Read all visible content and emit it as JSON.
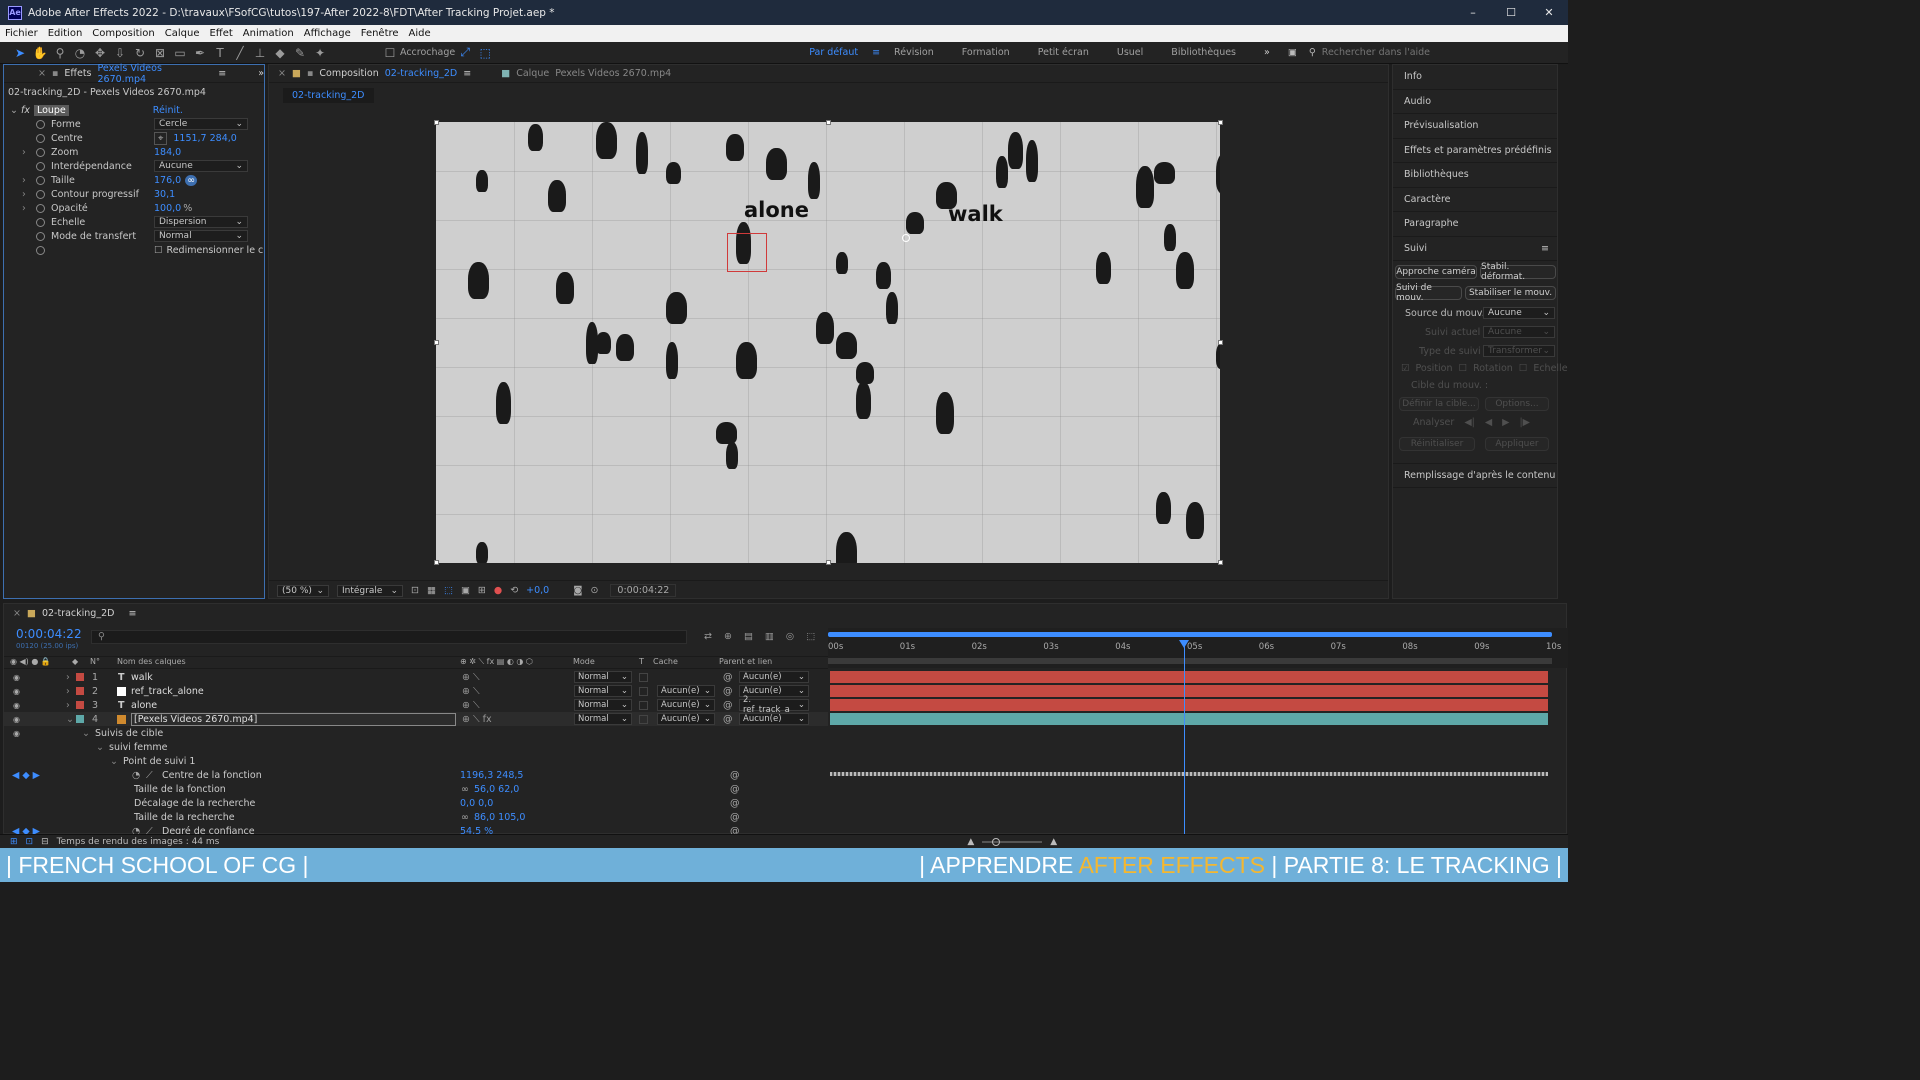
{
  "window": {
    "app_label": "Ae",
    "title": "Adobe After Effects 2022 - D:\\travaux\\FSofCG\\tutos\\197-After 2022-8\\FDT\\After Tracking Projet.aep *",
    "minimize": "–",
    "maximize": "☐",
    "close": "✕"
  },
  "menu": [
    "Fichier",
    "Edition",
    "Composition",
    "Calque",
    "Effet",
    "Animation",
    "Affichage",
    "Fenêtre",
    "Aide"
  ],
  "toolbar": {
    "snap_label": "Accrochage",
    "workspaces": [
      "Par défaut",
      "Révision",
      "Formation",
      "Petit écran",
      "Usuel",
      "Bibliothèques"
    ],
    "active_workspace": "Par défaut",
    "more": "»",
    "search_placeholder": "Rechercher dans l'aide"
  },
  "effects_panel": {
    "tab_label": "Effets",
    "tab_layer": "Pexels Videos 2670.mp4",
    "path": "02-tracking_2D - Pexels Videos 2670.mp4",
    "fx_label": "fx",
    "effect_name": "Loupe",
    "reset": "Réinit.",
    "props": [
      {
        "name": "Forme",
        "value": "Cercle",
        "kind": "dropdown"
      },
      {
        "name": "Centre",
        "value": "1151,7 284,0",
        "kind": "point"
      },
      {
        "name": "Zoom",
        "value": "184,0",
        "kind": "value"
      },
      {
        "name": "Interdépendance",
        "value": "Aucune",
        "kind": "dropdown"
      },
      {
        "name": "Taille",
        "value": "176,0",
        "kind": "value"
      },
      {
        "name": "Contour progressif",
        "value": "30,1",
        "kind": "value"
      },
      {
        "name": "Opacité",
        "value": "100,0",
        "unit": "%",
        "kind": "value"
      },
      {
        "name": "Echelle",
        "value": "Dispersion",
        "kind": "dropdown"
      },
      {
        "name": "Mode de transfert",
        "value": "Normal",
        "kind": "dropdown"
      },
      {
        "name": "",
        "value": "Redimensionner le c",
        "kind": "checkbox"
      }
    ]
  },
  "comp_panel": {
    "tab_label": "Composition",
    "comp_name": "02-tracking_2D",
    "layer_tab_label": "Calque",
    "layer_tab_name": "Pexels Videos 2670.mp4",
    "subtab": "02-tracking_2D",
    "overlay_texts": [
      "alone",
      "walk"
    ],
    "footer": {
      "zoom": "(50 %)",
      "resolution": "Intégrale",
      "exposure": "+0,0",
      "timecode": "0:00:04:22"
    }
  },
  "right_panel": {
    "items": [
      "Info",
      "Audio",
      "Prévisualisation",
      "Effets et paramètres prédéfinis",
      "Bibliothèques",
      "Caractère",
      "Paragraphe"
    ],
    "tracker": {
      "title": "Suivi",
      "buttons": [
        "Approche caméra",
        "Stabil. déformat.",
        "Suivi de mouv.",
        "Stabiliser le mouv."
      ],
      "source_label": "Source du mouv. :",
      "source_value": "Aucune",
      "current_label": "Suivi actuel",
      "current_value": "Aucune",
      "type_label": "Type de suivi",
      "type_value": "Transformer",
      "checks": [
        "Position",
        "Rotation",
        "Echelle"
      ],
      "target_label": "Cible du mouv. :",
      "define_target": "Définir la cible...",
      "options": "Options...",
      "analyze": "Analyser",
      "reset": "Réinitialiser",
      "apply": "Appliquer"
    },
    "fill_label": "Remplissage d'après le contenu"
  },
  "timeline": {
    "tab": "02-tracking_2D",
    "timecode": "0:00:04:22",
    "frame_info": "00120 (25.00 ips)",
    "columns": {
      "num": "N°",
      "name": "Nom des calques",
      "mode": "Mode",
      "t": "T",
      "matte": "Cache",
      "parent": "Parent et lien"
    },
    "ruler": [
      "00s",
      "01s",
      "02s",
      "03s",
      "04s",
      "05s",
      "06s",
      "07s",
      "08s",
      "09s",
      "10s"
    ],
    "playhead_seconds": 4.88,
    "duration_seconds": 10,
    "layers": [
      {
        "num": "1",
        "type": "T",
        "name": "walk",
        "mode": "Normal",
        "matte": "",
        "parent": "Aucun(e)",
        "color": "#c44a42"
      },
      {
        "num": "2",
        "type": "",
        "name": "ref_track_alone",
        "mode": "Normal",
        "matte": "Aucun(e)",
        "parent": "Aucun(e)",
        "color": "#c44a42"
      },
      {
        "num": "3",
        "type": "T",
        "name": "alone",
        "mode": "Normal",
        "matte": "Aucun(e)",
        "parent": "2. ref_track_a",
        "color": "#c44a42"
      },
      {
        "num": "4",
        "type": "",
        "name": "[Pexels Videos 2670.mp4]",
        "mode": "Normal",
        "matte": "Aucun(e)",
        "parent": "Aucun(e)",
        "color": "#5ea8a8"
      }
    ],
    "tree": [
      "Suivis de cible",
      "suivi femme",
      "Point de suivi 1"
    ],
    "track_props": [
      {
        "name": "Centre de la fonction",
        "value": "1196,3 248,5"
      },
      {
        "name": "Taille de la fonction",
        "value": "56,0 62,0"
      },
      {
        "name": "Décalage de la recherche",
        "value": "0,0 0,0"
      },
      {
        "name": "Taille de la recherche",
        "value": "86,0 105,0"
      },
      {
        "name": "Degré de confiance",
        "value": "54,5 %"
      }
    ],
    "status": "Temps de rendu des images : 44 ms"
  },
  "banner": {
    "left": "| FRENCH SCHOOL OF CG |",
    "right_prefix": "| APPRENDRE ",
    "right_highlight": "AFTER EFFECTS",
    "right_suffix": " | PARTIE 8: LE TRACKING |"
  },
  "colors": {
    "accent": "#3d8dff",
    "layer_red": "#c44a42",
    "layer_teal": "#5ea8a8",
    "banner": "#6fb0d9",
    "banner_highlight": "#f4b730"
  }
}
